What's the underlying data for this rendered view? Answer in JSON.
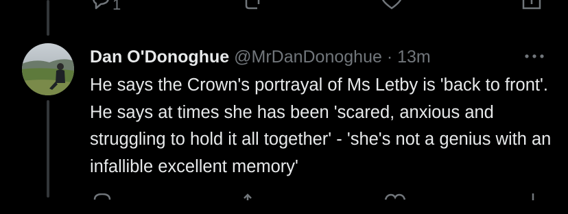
{
  "tweet": {
    "author_name": "Dan O'Donoghue",
    "handle": "@MrDanDonoghue",
    "separator": "·",
    "time": "13m",
    "text": "He says the Crown's portrayal of Ms Letby is 'back to front'. He says at times she has been 'scared, anxious and struggling to hold it all together' - 'she's not a genius with an infallible excellent memory'"
  },
  "previous_tweet_actions": {
    "reply_count": "1"
  },
  "icons": {
    "reply": "reply-icon",
    "retweet": "retweet-icon",
    "like": "like-icon",
    "share": "share-icon",
    "more": "more-icon"
  },
  "colors": {
    "background": "#000000",
    "text": "#e7e9ea",
    "muted": "#71767b",
    "thread_line": "#333639"
  }
}
